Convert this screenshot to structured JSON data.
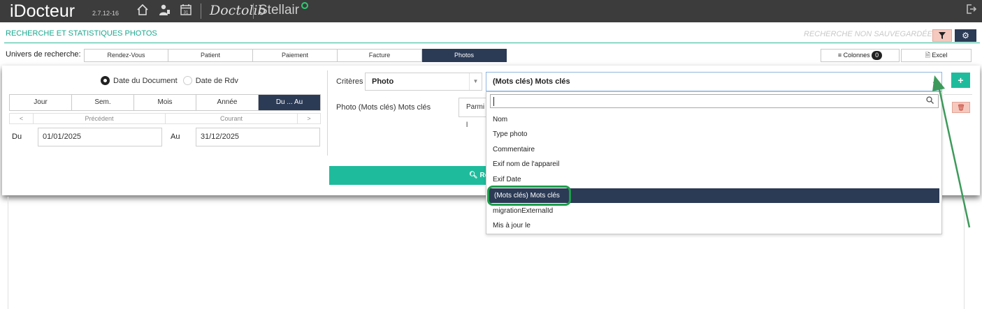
{
  "app": {
    "title": "iDocteur",
    "version": "2.7.12-16",
    "doctolib": "Doctolib",
    "stellair": "Stellair",
    "icons": [
      "home-icon",
      "user-icon",
      "calendar-icon",
      "logout-icon"
    ],
    "calendar_day": "31"
  },
  "header": {
    "page_title": "RECHERCHE ET STATISTIQUES PHOTOS",
    "save_status": "RECHERCHE NON SAUVEGARDÉE",
    "accent_color": "#1aa88e",
    "dark_color": "#2b3a55"
  },
  "univers": {
    "label": "Univers de recherche:",
    "tabs": [
      "Rendez-Vous",
      "Patient",
      "Paiement",
      "Facture",
      "Photos"
    ],
    "active_tab": "Photos",
    "colonnes_label": "Colonnes",
    "colonnes_count": "0",
    "excel_label": "Excel"
  },
  "date_filter": {
    "radio_document": "Date du Document",
    "radio_rdv": "Date de Rdv",
    "period_tabs": [
      "Jour",
      "Sem.",
      "Mois",
      "Année",
      "Du ... Au"
    ],
    "active_period": "Du ... Au",
    "nav": [
      "<",
      "Précédent",
      "Courant",
      ">"
    ],
    "du_label": "Du",
    "du_value": "01/01/2025",
    "au_label": "Au",
    "au_value": "31/12/2025"
  },
  "criteria": {
    "label": "Critères",
    "entity_select": "Photo",
    "field_select": "(Mots clés) Mots clés",
    "row_label": "Photo (Mots clés) Mots clés",
    "operator": "Parmi l",
    "search_button": "Re",
    "dropdown_search_value": "",
    "dropdown_items": [
      "Nom",
      "Type photo",
      "Commentaire",
      "Exif nom de l'appareil",
      "Exif Date",
      "(Mots clés) Mots clés",
      "migrationExternalId",
      "Mis à jour le"
    ],
    "selected_item": "(Mots clés) Mots clés"
  }
}
